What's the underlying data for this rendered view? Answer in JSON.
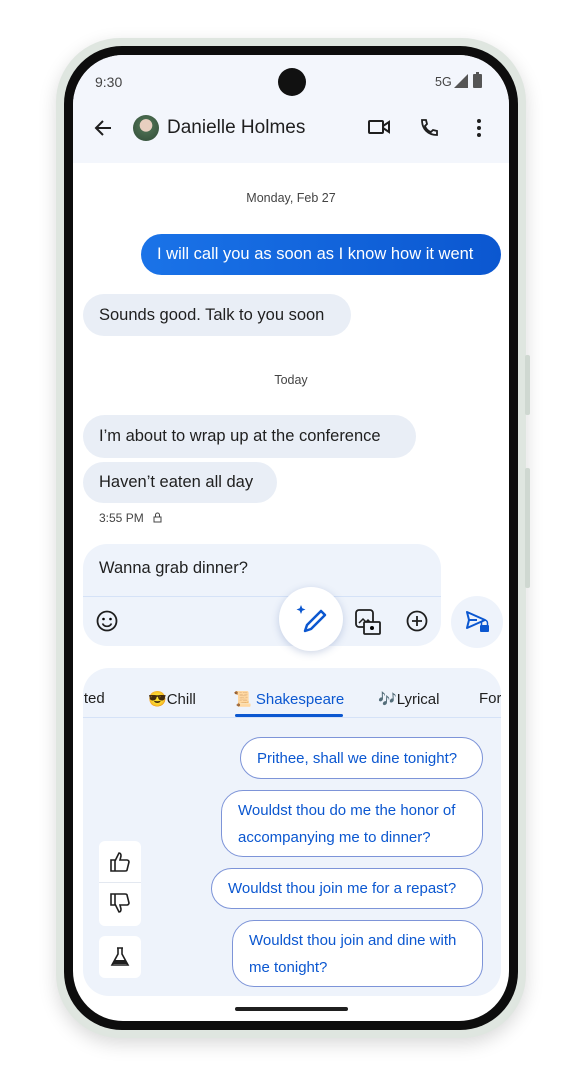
{
  "status": {
    "time": "9:30",
    "network": "5G"
  },
  "header": {
    "contact_name": "Danielle Holmes"
  },
  "messages": [
    {
      "type": "date",
      "text": "Monday, Feb 27"
    },
    {
      "type": "sent",
      "text": "I will call you as soon as I know how it went"
    },
    {
      "type": "received",
      "text": "Sounds good. Talk to you soon"
    },
    {
      "type": "date",
      "text": "Today"
    },
    {
      "type": "received",
      "text": "I’m about to wrap up at the conference"
    },
    {
      "type": "received",
      "text": "Haven’t eaten all day"
    },
    {
      "type": "timestamp",
      "text": "3:55 PM"
    }
  ],
  "compose": {
    "value": "Wanna grab dinner?"
  },
  "tabs": [
    {
      "label": "cited"
    },
    {
      "emoji": "😎",
      "label": "Chill"
    },
    {
      "emoji": "📜",
      "label": "Shakespeare",
      "active": true
    },
    {
      "emoji": "🎶",
      "label": "Lyrical"
    },
    {
      "label": "For"
    }
  ],
  "suggestions": [
    "Prithee, shall we dine tonight?",
    "Wouldst thou do me the honor of accompanying me to dinner?",
    "Wouldst thou join me for a repast?",
    "Wouldst thou join and dine with me tonight?"
  ],
  "colors": {
    "accent": "#0b57d0",
    "surface": "#eef3fb",
    "sent_bubble": "#1a73e8"
  }
}
